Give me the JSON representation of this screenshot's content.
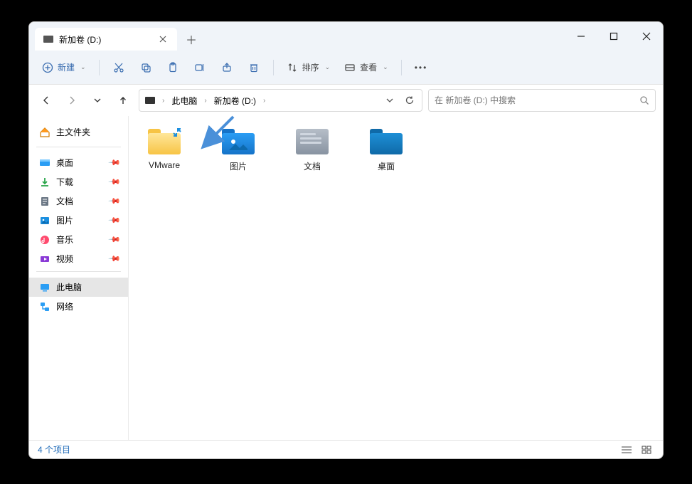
{
  "tab": {
    "title": "新加卷 (D:)"
  },
  "toolbar": {
    "new": "新建",
    "sort": "排序",
    "view": "查看"
  },
  "breadcrumbs": [
    "此电脑",
    "新加卷 (D:)"
  ],
  "search": {
    "placeholder": "在 新加卷 (D:) 中搜索"
  },
  "sidebar": {
    "home": "主文件夹",
    "quick": [
      {
        "label": "桌面"
      },
      {
        "label": "下载"
      },
      {
        "label": "文档"
      },
      {
        "label": "图片"
      },
      {
        "label": "音乐"
      },
      {
        "label": "视频"
      }
    ],
    "thispc": "此电脑",
    "network": "网络"
  },
  "items": [
    {
      "name": "VMware"
    },
    {
      "name": "图片"
    },
    {
      "name": "文档"
    },
    {
      "name": "桌面"
    }
  ],
  "status": {
    "count": "4 个项目"
  }
}
